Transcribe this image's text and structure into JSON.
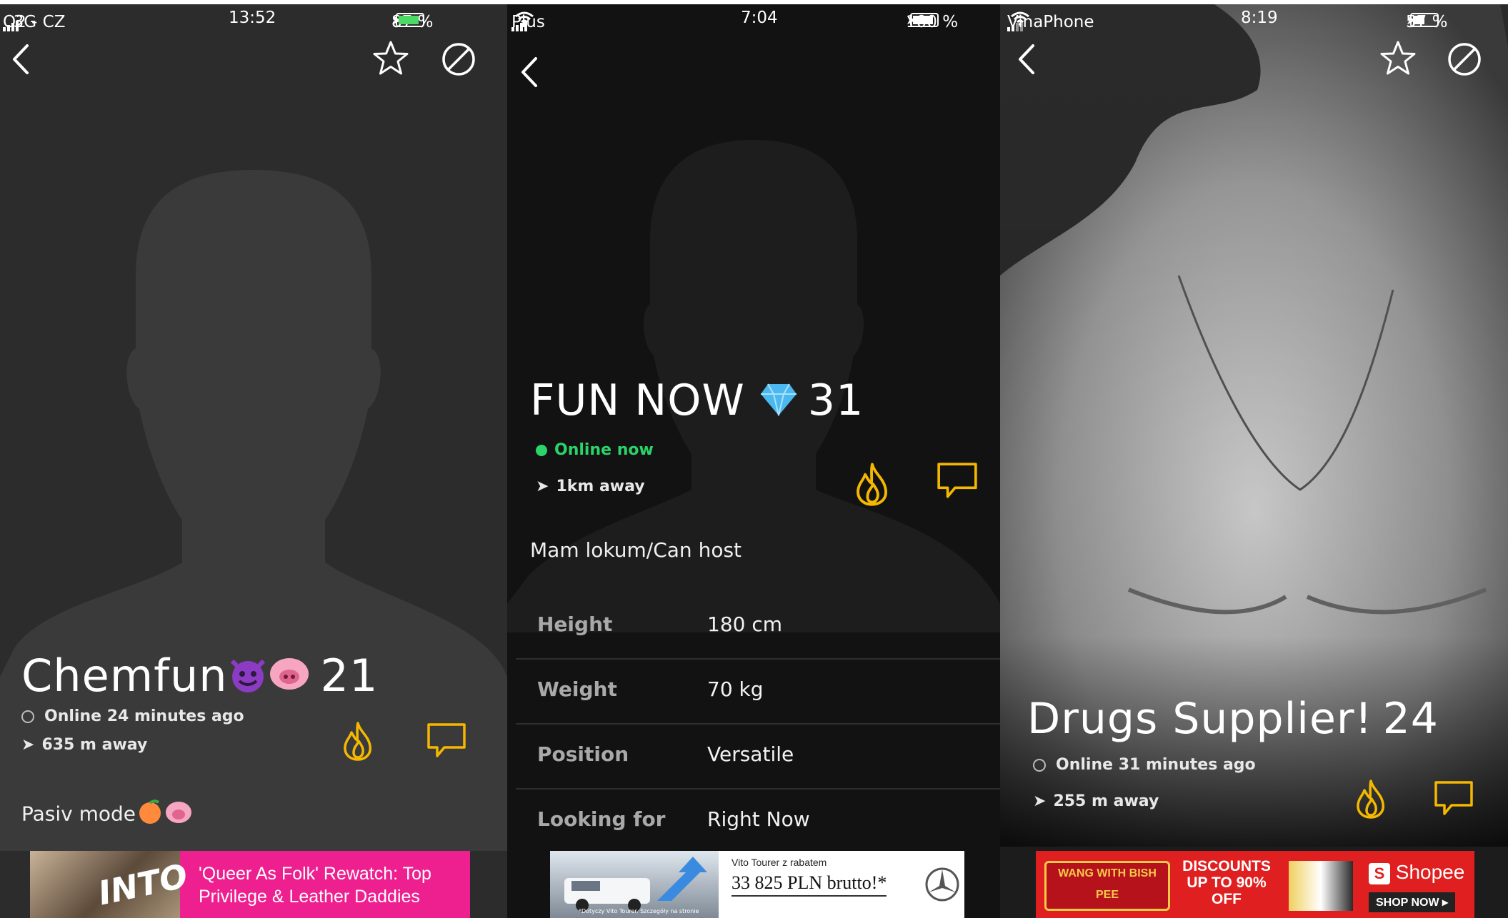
{
  "screens": [
    {
      "status": {
        "carrier": "O2 - CZ",
        "network": "3G",
        "time": "13:52",
        "battery": "87 %",
        "battery_level": 0.87
      },
      "profile": {
        "name": "Chemfun",
        "age": "21",
        "online": "Online 24 minutes ago",
        "distance": "635 m away",
        "bio": "Pasiv mode"
      },
      "ad": {
        "brand": "INTO",
        "headline": "'Queer As Folk' Rewatch: Top Privilege & Leather Daddies"
      }
    },
    {
      "status": {
        "carrier": "Plus",
        "time": "7:04",
        "battery": "100 %",
        "battery_level": 1.0
      },
      "profile": {
        "name": "FUN NOW",
        "age": "31",
        "online": "Online now",
        "distance": "1km away",
        "bio": "Mam lokum/Can host",
        "stats": [
          {
            "label": "Height",
            "value": "180 cm"
          },
          {
            "label": "Weight",
            "value": "70 kg"
          },
          {
            "label": "Position",
            "value": "Versatile"
          },
          {
            "label": "Looking for",
            "value": "Right Now"
          }
        ]
      },
      "ad": {
        "subline": "Vito Tourer z rabatem",
        "price": "33 825 PLN brutto!*",
        "fineprint": "*Dotyczy Vito Tourer. Szczegóły na stronie"
      }
    },
    {
      "status": {
        "carrier": "VinaPhone",
        "time": "8:19",
        "battery": "57 %",
        "battery_level": 0.57
      },
      "profile": {
        "name": "Drugs Supplier!",
        "age": "24",
        "online": "Online 31 minutes ago",
        "distance": "255 m away"
      },
      "ad": {
        "left": "WANG WITH BISH PEE",
        "middle": "DISCOUNTS UP TO 90% OFF",
        "brand": "Shopee",
        "cta": "SHOP NOW"
      }
    }
  ],
  "colors": {
    "accent": "#f5b800",
    "online_green": "#2bd46a",
    "ad_pink": "#ee1f8f",
    "shopee_red": "#e02020"
  },
  "icons": [
    "back-icon",
    "star-icon",
    "block-icon",
    "flame-icon",
    "chat-icon",
    "location-arrow-icon",
    "diamond-icon",
    "devil-emoji-icon",
    "pig-emoji-icon",
    "peach-emoji-icon",
    "mercedes-logo-icon"
  ]
}
